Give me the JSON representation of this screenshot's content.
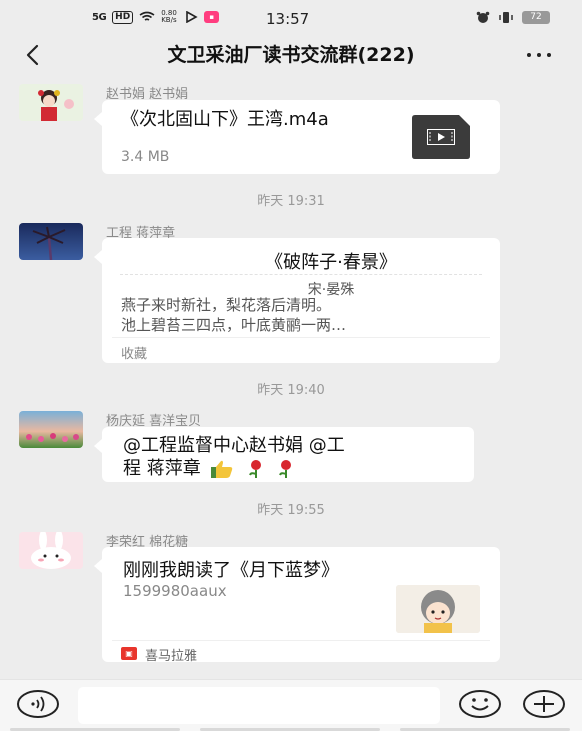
{
  "status_bar": {
    "signal": "5G",
    "hd": "HD",
    "speed": "0.80 KB/s",
    "time": "13:57",
    "battery": "72"
  },
  "header": {
    "title": "文卫采油厂读书交流群(222)"
  },
  "messages": [
    {
      "sender": "赵书娟  赵书娟",
      "file_name": "《次北固山下》王湾.m4a",
      "file_size": "3.4 MB"
    },
    {
      "timestamp": "昨天 19:31",
      "sender": "工程  蒋萍章",
      "note_title": "《破阵子·春景》",
      "note_author": "宋·晏殊",
      "note_line1": "燕子来时新社，梨花落后清明。",
      "note_line2": "池上碧苔三四点，叶底黄鹂一两…",
      "note_footer": "收藏"
    },
    {
      "timestamp": "昨天 19:40",
      "sender": "杨庆延 喜洋宝贝",
      "text_line1": "@工程监督中心赵书娟  @工",
      "text_line2": "程  蒋萍章"
    },
    {
      "timestamp": "昨天 19:55",
      "sender": "李荣红  棉花糖",
      "mp_title": "刚刚我朗读了《月下蓝梦》",
      "mp_sub": "1599980aaux",
      "mp_source": "喜马拉雅"
    }
  ],
  "icons": {
    "back": "back-arrow-icon",
    "more": "more-icon",
    "voice": "voice-icon",
    "emoji": "emoji-icon",
    "plus": "plus-icon"
  },
  "colors": {
    "background": "#ededed",
    "bubble": "#ffffff",
    "timestamp": "#999999",
    "ximalaya": "#e8352c"
  }
}
